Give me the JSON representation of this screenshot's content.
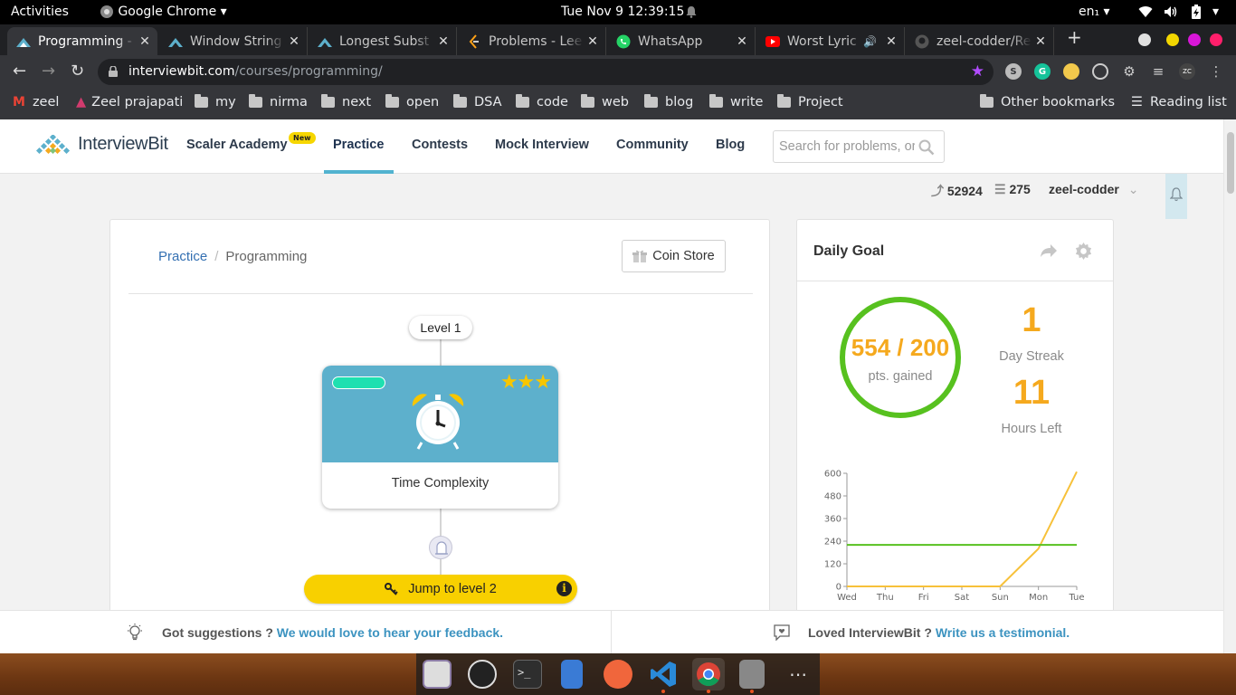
{
  "system_bar": {
    "activities": "Activities",
    "app_name": "Google Chrome",
    "clock": "Tue Nov 9  12:39:15",
    "language": "en₁"
  },
  "tabs": [
    {
      "title": "Programming - ",
      "active": true,
      "favicon": "interviewbit-icon"
    },
    {
      "title": "Window String",
      "active": false,
      "favicon": "interviewbit-icon"
    },
    {
      "title": "Longest Subst",
      "active": false,
      "favicon": "interviewbit-icon"
    },
    {
      "title": "Problems - Lee",
      "active": false,
      "favicon": "leetcode-icon"
    },
    {
      "title": "WhatsApp",
      "active": false,
      "favicon": "whatsapp-icon"
    },
    {
      "title": "Worst Lyric",
      "active": false,
      "favicon": "youtube-icon"
    },
    {
      "title": "zeel-codder/Re",
      "active": false,
      "favicon": "github-icon"
    }
  ],
  "address_bar": {
    "domain": "interviewbit.com",
    "path": "/courses/programming/"
  },
  "bookmarks": {
    "items": [
      "zeel",
      "Zeel prajapati",
      "my",
      "nirma",
      "next",
      "open",
      "DSA",
      "code",
      "web",
      "blog",
      "write",
      "Project"
    ],
    "other": "Other bookmarks",
    "reading_list": "Reading list"
  },
  "site_header": {
    "logo": "InterviewBit",
    "nav": [
      "Scaler Academy",
      "Practice",
      "Contests",
      "Mock Interview",
      "Community",
      "Blog"
    ],
    "new_badge": "New",
    "search_placeholder": "Search for problems, or"
  },
  "user_bar": {
    "streak_points": "52924",
    "coins": "275",
    "username": "zeel-codder"
  },
  "breadcrumb": {
    "root": "Practice",
    "separator": "/",
    "current": "Programming"
  },
  "coin_store_label": "Coin Store",
  "level": {
    "label": "Level 1",
    "topic": "Time Complexity",
    "stars": "★★★",
    "jump_label": "Jump to level 2",
    "info_glyph": "i"
  },
  "daily_goal": {
    "title": "Daily Goal",
    "points": "554 / 200",
    "points_label": "pts. gained",
    "streak_value": "1",
    "streak_label": "Day Streak",
    "hours_value": "11",
    "hours_label": "Hours Left"
  },
  "chart_data": {
    "type": "line",
    "categories": [
      "Wed",
      "Thu",
      "Fri",
      "Sat",
      "Sun",
      "Mon",
      "Tue"
    ],
    "ylim": [
      0,
      600
    ],
    "yticks": [
      0,
      120,
      240,
      360,
      480,
      600
    ],
    "series": [
      {
        "values": [
          0,
          0,
          0,
          0,
          0,
          200,
          608
        ],
        "color": "#f7c13a"
      },
      {
        "values": [
          220,
          220,
          220,
          220,
          220,
          220,
          220
        ],
        "color": "#57c11f"
      }
    ]
  },
  "footer": {
    "left_static": "Got suggestions ? ",
    "left_link": "We would love to hear your feedback.",
    "right_static": "Loved InterviewBit ? ",
    "right_link": "Write us a testimonial."
  }
}
